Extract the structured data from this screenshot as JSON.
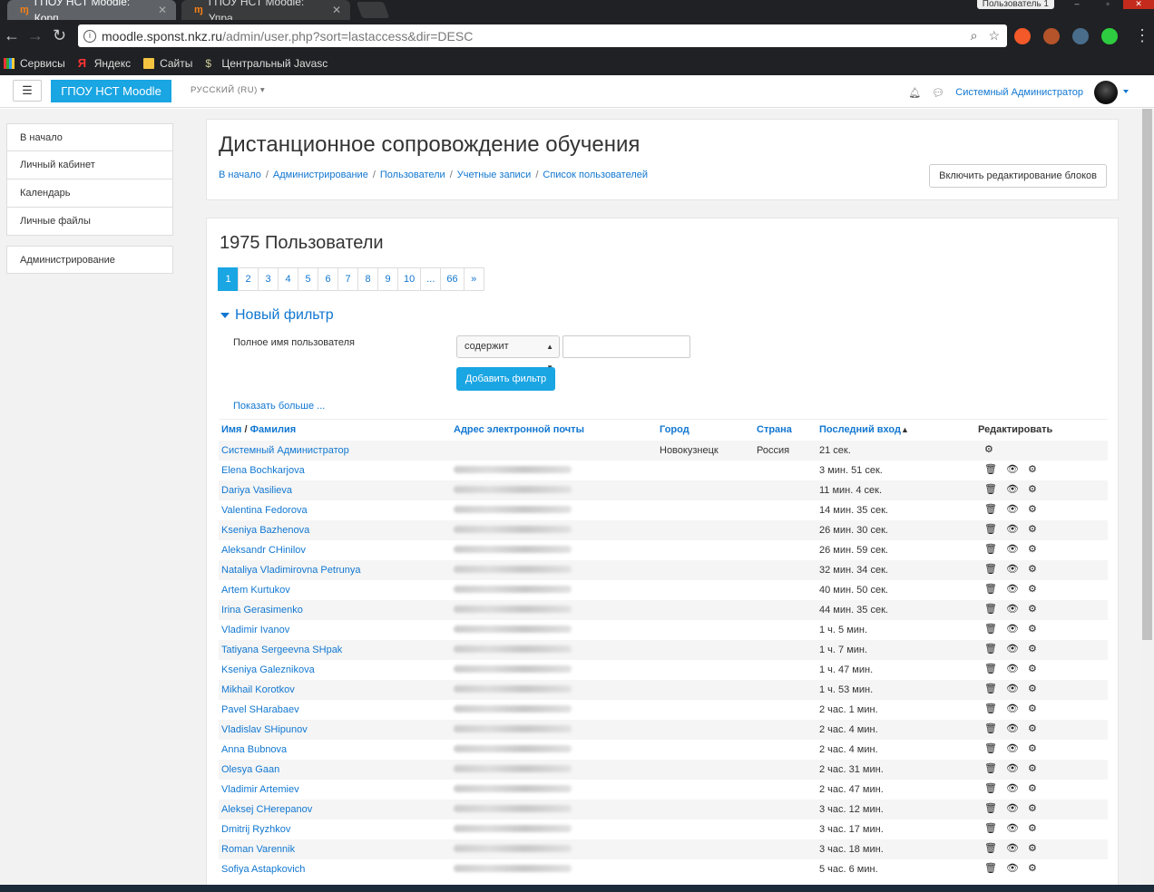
{
  "browser": {
    "tabs": [
      {
        "title": "ГПОУ НСТ Moodle: Корп",
        "active": true
      },
      {
        "title": "ГПОУ НСТ Moodle: Упра",
        "active": false
      }
    ],
    "profile": "Пользователь 1",
    "url_host": "moodle.sponst.nkz.ru",
    "url_path": "/admin/user.php?sort=lastaccess&dir=DESC",
    "bookmarks": [
      "Сервисы",
      "Яндекс",
      "Сайты",
      "Центральный Javasc"
    ]
  },
  "navbar": {
    "brand": "ГПОУ НСТ Moodle",
    "language": "РУССКИЙ (RU)",
    "user_name": "Системный Администратор"
  },
  "sidebar": {
    "items": [
      "В начало",
      "Личный кабинет",
      "Календарь",
      "Личные файлы"
    ],
    "admin": "Администрирование"
  },
  "header": {
    "title": "Дистанционное сопровождение обучения",
    "breadcrumb": [
      "В начало",
      "Администрирование",
      "Пользователи",
      "Учетные записи",
      "Список пользователей"
    ],
    "edit_button": "Включить редактирование блоков"
  },
  "main": {
    "count_title": "1975 Пользователи",
    "pages": [
      "1",
      "2",
      "3",
      "4",
      "5",
      "6",
      "7",
      "8",
      "9",
      "10",
      "...",
      "66",
      "»"
    ],
    "filter": {
      "legend": "Новый фильтр",
      "label": "Полное имя пользователя",
      "operator": "содержит",
      "value": "",
      "add_button": "Добавить фильтр",
      "show_more": "Показать больше ..."
    },
    "columns": {
      "name_first": "Имя",
      "name_sep": " / ",
      "name_last": "Фамилия",
      "email": "Адрес электронной почты",
      "city": "Город",
      "country": "Страна",
      "last_access": "Последний вход",
      "edit": "Редактировать"
    },
    "rows": [
      {
        "name": "Системный Администратор",
        "city": "Новокузнецк",
        "country": "Россия",
        "last": "21 сек.",
        "admin": true
      },
      {
        "name": "Elena Bochkarjova",
        "city": "",
        "country": "",
        "last": "3 мин. 51 сек."
      },
      {
        "name": "Dariya Vasilieva",
        "city": "",
        "country": "",
        "last": "11 мин. 4 сек."
      },
      {
        "name": "Valentina Fedorova",
        "city": "",
        "country": "",
        "last": "14 мин. 35 сек."
      },
      {
        "name": "Kseniya Bazhenova",
        "city": "",
        "country": "",
        "last": "26 мин. 30 сек."
      },
      {
        "name": "Aleksandr CHinilov",
        "city": "",
        "country": "",
        "last": "26 мин. 59 сек."
      },
      {
        "name": "Nataliya Vladimirovna Petrunya",
        "city": "",
        "country": "",
        "last": "32 мин. 34 сек."
      },
      {
        "name": "Artem Kurtukov",
        "city": "",
        "country": "",
        "last": "40 мин. 50 сек."
      },
      {
        "name": "Irina Gerasimenko",
        "city": "",
        "country": "",
        "last": "44 мин. 35 сек."
      },
      {
        "name": "Vladimir Ivanov",
        "city": "",
        "country": "",
        "last": "1 ч. 5 мин."
      },
      {
        "name": "Tatiyana Sergeevna SHpak",
        "city": "",
        "country": "",
        "last": "1 ч. 7 мин."
      },
      {
        "name": "Kseniya Galeznikova",
        "city": "",
        "country": "",
        "last": "1 ч. 47 мин."
      },
      {
        "name": "Mikhail Korotkov",
        "city": "",
        "country": "",
        "last": "1 ч. 53 мин."
      },
      {
        "name": "Pavel SHarabaev",
        "city": "",
        "country": "",
        "last": "2 час. 1 мин."
      },
      {
        "name": "Vladislav SHipunov",
        "city": "",
        "country": "",
        "last": "2 час. 4 мин."
      },
      {
        "name": "Anna Bubnova",
        "city": "",
        "country": "",
        "last": "2 час. 4 мин."
      },
      {
        "name": "Olesya Gaan",
        "city": "",
        "country": "",
        "last": "2 час. 31 мин."
      },
      {
        "name": "Vladimir Artemiev",
        "city": "",
        "country": "",
        "last": "2 час. 47 мин."
      },
      {
        "name": "Aleksej CHerepanov",
        "city": "",
        "country": "",
        "last": "3 час. 12 мин."
      },
      {
        "name": "Dmitrij Ryzhkov",
        "city": "",
        "country": "",
        "last": "3 час. 17 мин."
      },
      {
        "name": "Roman Varennik",
        "city": "",
        "country": "",
        "last": "3 час. 18 мин."
      },
      {
        "name": "Sofiya Astapkovich",
        "city": "",
        "country": "",
        "last": "5 час. 6 мин."
      }
    ]
  },
  "icons": {
    "delete": "trash-icon",
    "view": "eye-icon",
    "settings": "gear-icon"
  },
  "colors": {
    "accent": "#1aa5e3",
    "link": "#1177d1"
  }
}
